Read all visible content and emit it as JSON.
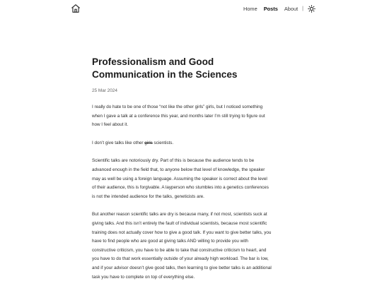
{
  "header": {
    "nav": {
      "home_label": "Home",
      "posts_label": "Posts",
      "about_label": "About",
      "separator": "|"
    },
    "icons": {
      "home": "home-icon",
      "theme": "sun-icon"
    }
  },
  "post": {
    "title": "Professionalism and Good Communication in the Sciences",
    "date": "25 Mar 2024",
    "p1": "I really do hate to be one of those “not like the other girls” girls, but I noticed something when I gave a talk at a conference this year, and months later I’m still trying to figure out how I feel about it.",
    "p2_before": "I don’t give talks like other ",
    "p2_struck": "girls",
    "p2_after": " scientists.",
    "p3": "Scientific talks are notoriously dry. Part of this is because the audience tends to be advanced enough in the field that, to anyone below that level of knowledge, the speaker may as well be using a foreign language. Assuming the speaker is correct about the level of their audience, this is forgivable. A layperson who stumbles into a genetics conferences is not the intended audience for the talks, geneticists are.",
    "p4": "But another reason scientific talks are dry is because many, if not most, scientists suck at giving talks. And this isn’t entirely the fault of individual scientists, because most scientific training does not actually cover how to give a good talk. If you want to give better talks, you have to find people who are good at giving talks AND willing to provide you with constructive criticism, you have to be able to take that constructive criticism to heart, and you have to do that work essentially outside of your already high workload. The bar is low, and if your advisor doesn’t give good talks, then learning to give better talks is an additional task you have to complete on top of everything else."
  }
}
